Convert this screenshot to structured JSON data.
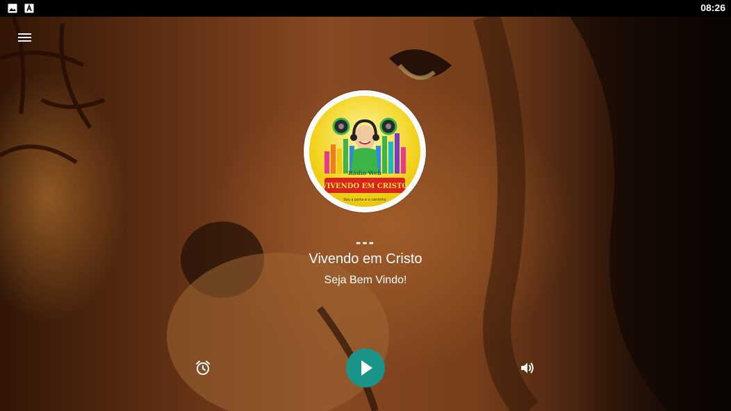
{
  "status_bar": {
    "time": "08:26",
    "icons": [
      "image-icon",
      "font-icon"
    ]
  },
  "header": {
    "menu_icon": "hamburger-menu-icon"
  },
  "player": {
    "song_title": "---",
    "station_name": "Vivendo em Cristo",
    "slogan": "Seja Bem Vindo!",
    "logo": {
      "top_text": "Rádio Web",
      "main_text": "VIVENDO EM CRISTO",
      "bottom_text": "Sou a porta é o caminho"
    }
  },
  "controls": {
    "alarm_icon": "alarm-clock-icon",
    "play_icon": "play-icon",
    "volume_icon": "volume-icon"
  },
  "colors": {
    "accent": "#1a9488",
    "logo_yellow": "#f2d21b",
    "logo_red": "#d8241c"
  }
}
